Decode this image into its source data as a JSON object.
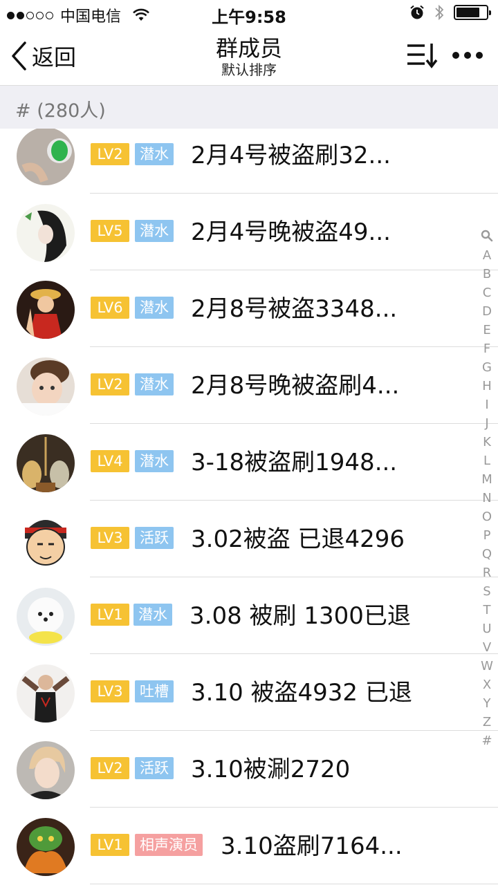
{
  "status_bar": {
    "carrier": "中国电信",
    "time": "上午9:58"
  },
  "nav": {
    "back_label": "返回",
    "title": "群成员",
    "subtitle": "默认排序"
  },
  "section": {
    "header": "# (280人)"
  },
  "members": [
    {
      "level": "LV2",
      "status": "潜水",
      "status_color": "#8ec5f0",
      "name": "2月4号被盗刷32..."
    },
    {
      "level": "LV5",
      "status": "潜水",
      "status_color": "#8ec5f0",
      "name": "2月4号晚被盗49..."
    },
    {
      "level": "LV6",
      "status": "潜水",
      "status_color": "#8ec5f0",
      "name": "2月8号被盗3348..."
    },
    {
      "level": "LV2",
      "status": "潜水",
      "status_color": "#8ec5f0",
      "name": "2月8号晚被盗刷4..."
    },
    {
      "level": "LV4",
      "status": "潜水",
      "status_color": "#8ec5f0",
      "name": "3-18被盗刷1948..."
    },
    {
      "level": "LV3",
      "status": "活跃",
      "status_color": "#8ec5f0",
      "name": "3.02被盗 已退4296"
    },
    {
      "level": "LV1",
      "status": "潜水",
      "status_color": "#8ec5f0",
      "name": "3.08 被刷 1300已退"
    },
    {
      "level": "LV3",
      "status": "吐槽",
      "status_color": "#8ec5f0",
      "name": "3.10 被盗4932 已退"
    },
    {
      "level": "LV2",
      "status": "活跃",
      "status_color": "#8ec5f0",
      "name": "3.10被涮2720"
    },
    {
      "level": "LV1",
      "status": "相声演员",
      "status_color": "#f5a0a0",
      "name": "3.10盗刷7164..."
    }
  ],
  "index_letters": [
    "A",
    "B",
    "C",
    "D",
    "E",
    "F",
    "G",
    "H",
    "I",
    "J",
    "K",
    "L",
    "M",
    "N",
    "O",
    "P",
    "Q",
    "R",
    "S",
    "T",
    "U",
    "V",
    "W",
    "X",
    "Y",
    "Z",
    "#"
  ],
  "colors": {
    "level_badge": "#f6c233",
    "status_blue": "#8ec5f0",
    "status_red": "#f5a0a0",
    "section_bg": "#efeff4"
  }
}
